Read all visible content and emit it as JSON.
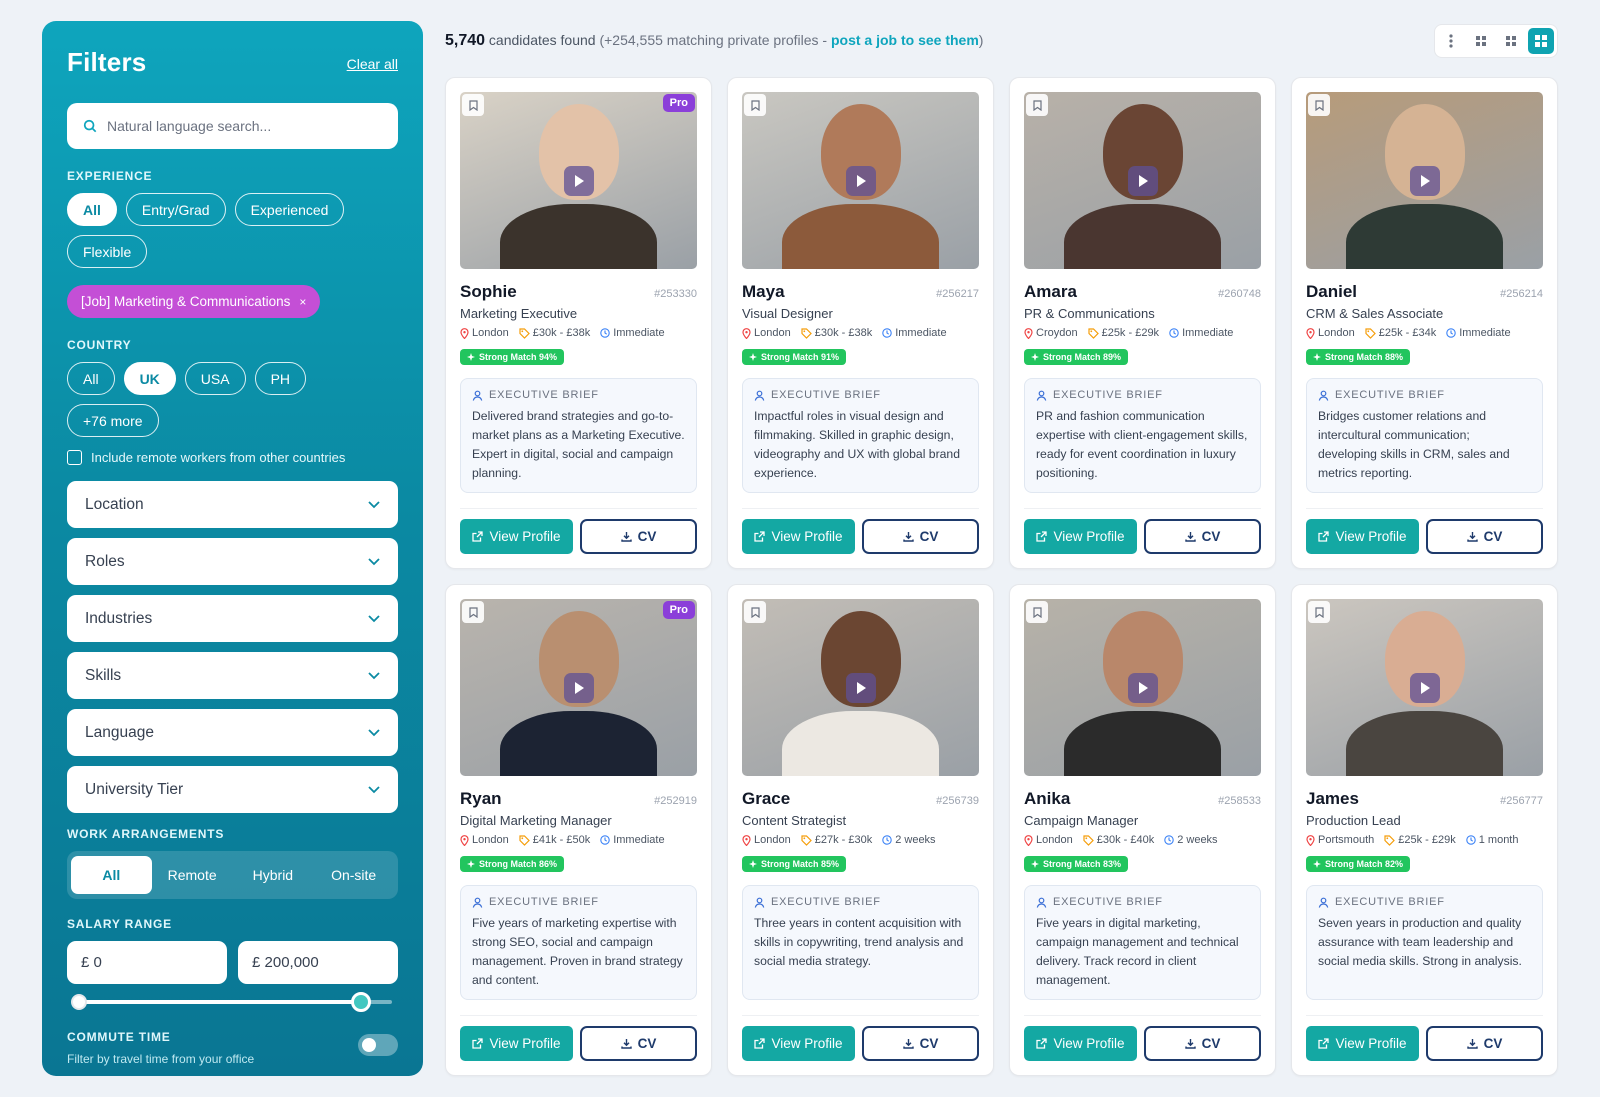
{
  "sidebar": {
    "title": "Filters",
    "clear_all": "Clear all",
    "search_placeholder": "Natural language search...",
    "experience_label": "EXPERIENCE",
    "experience_options": [
      "All",
      "Entry/Grad",
      "Experienced",
      "Flexible"
    ],
    "job_chip": "[Job] Marketing & Communications",
    "job_chip_close": "×",
    "country_label": "COUNTRY",
    "country_options": [
      "All",
      "UK",
      "USA",
      "PH",
      "+76 more"
    ],
    "remote_label": "Include remote workers from other countries",
    "dropdowns": [
      "Location",
      "Roles",
      "Industries",
      "Skills",
      "Language",
      "University Tier"
    ],
    "work_label": "WORK ARRANGEMENTS",
    "work_options": [
      "All",
      "Remote",
      "Hybrid",
      "On-site"
    ],
    "salary_label": "SALARY RANGE",
    "salary_min": "£ 0",
    "salary_max": "£ 200,000",
    "commute_label": "COMMUTE TIME",
    "commute_sub": "Filter by travel time from your office"
  },
  "topbar": {
    "count": "5,740",
    "count_suffix": " candidates found ",
    "private": "(+254,555 matching private profiles - ",
    "link": "post a job to see them",
    "close": ")"
  },
  "labels": {
    "brief": "EXECUTIVE BRIEF",
    "view_profile": "View Profile",
    "cv": "CV",
    "pro": "Pro"
  },
  "colors": {
    "primary": "#0ea5bd",
    "match": "#22c55e",
    "pro": "#8b3fd9",
    "chip": "#c44fd6"
  },
  "cards": [
    {
      "name": "Sophie",
      "id": "#253330",
      "role": "Marketing Executive",
      "location": "London",
      "salary": "£30k - £38k",
      "availability": "Immediate",
      "match": "Strong Match 94%",
      "pro": true,
      "brief": "Delivered brand strategies and go-to-market plans as a Marketing Executive. Expert in digital, social and campaign planning."
    },
    {
      "name": "Maya",
      "id": "#256217",
      "role": "Visual Designer",
      "location": "London",
      "salary": "£30k - £38k",
      "availability": "Immediate",
      "match": "Strong Match 91%",
      "pro": false,
      "brief": "Impactful roles in visual design and filmmaking. Skilled in graphic design, videography and UX with global brand experience."
    },
    {
      "name": "Amara",
      "id": "#260748",
      "role": "PR & Communications",
      "location": "Croydon",
      "salary": "£25k - £29k",
      "availability": "Immediate",
      "match": "Strong Match 89%",
      "pro": false,
      "brief": "PR and fashion communication expertise with client-engagement skills, ready for event coordination in luxury positioning."
    },
    {
      "name": "Daniel",
      "id": "#256214",
      "role": "CRM & Sales Associate",
      "location": "London",
      "salary": "£25k - £34k",
      "availability": "Immediate",
      "match": "Strong Match 88%",
      "pro": false,
      "brief": "Bridges customer relations and intercultural communication; developing skills in CRM, sales and metrics reporting."
    },
    {
      "name": "Ryan",
      "id": "#252919",
      "role": "Digital Marketing Manager",
      "location": "London",
      "salary": "£41k - £50k",
      "availability": "Immediate",
      "match": "Strong Match 86%",
      "pro": true,
      "brief": "Five years of marketing expertise with strong SEO, social and campaign management. Proven in brand strategy and content."
    },
    {
      "name": "Grace",
      "id": "#256739",
      "role": "Content Strategist",
      "location": "London",
      "salary": "£27k - £30k",
      "availability": "2 weeks",
      "match": "Strong Match 85%",
      "pro": false,
      "brief": "Three years in content acquisition with skills in copywriting, trend analysis and social media strategy."
    },
    {
      "name": "Anika",
      "id": "#258533",
      "role": "Campaign Manager",
      "location": "London",
      "salary": "£30k - £40k",
      "availability": "2 weeks",
      "match": "Strong Match 83%",
      "pro": false,
      "brief": "Five years in digital marketing, campaign management and technical delivery. Track record in client management."
    },
    {
      "name": "James",
      "id": "#256777",
      "role": "Production Lead",
      "location": "Portsmouth",
      "salary": "£25k - £29k",
      "availability": "1 month",
      "match": "Strong Match 82%",
      "pro": false,
      "brief": "Seven years in production and quality assurance with team leadership and social media skills. Strong in analysis."
    }
  ]
}
